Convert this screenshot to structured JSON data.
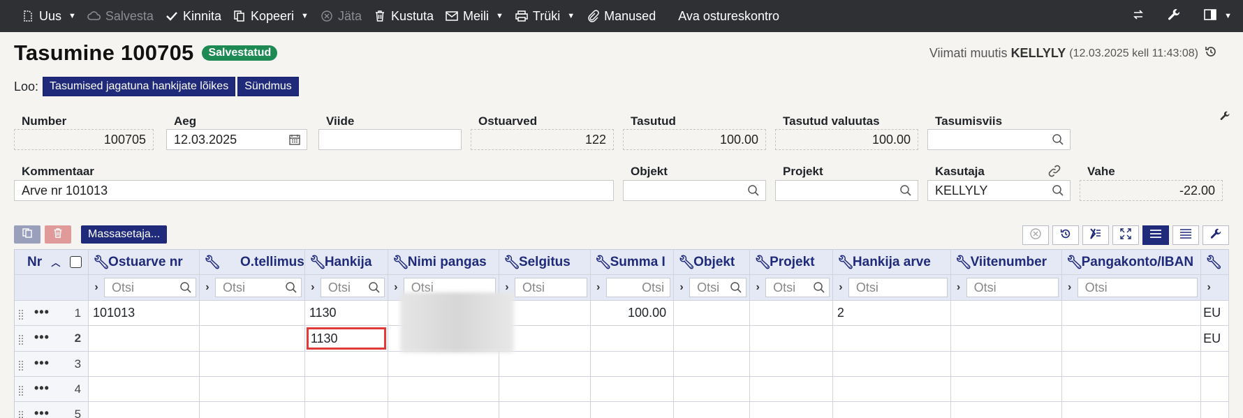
{
  "toolbar": {
    "uus": "Uus",
    "salvesta": "Salvesta",
    "kinnita": "Kinnita",
    "kopeeri": "Kopeeri",
    "jata": "Jäta",
    "kustuta": "Kustuta",
    "meili": "Meili",
    "truki": "Trüki",
    "manused": "Manused",
    "ava_ostureskontro": "Ava ostureskontro"
  },
  "header": {
    "title": "Tasumine 100705",
    "status": "Salvestatud",
    "modified_prefix": "Viimati muutis",
    "modified_user": "KELLYLY",
    "modified_time": "(12.03.2025 kell 11:43:08)"
  },
  "loo": {
    "label": "Loo:",
    "buttons": [
      "Tasumised jagatuna hankijate lõikes",
      "Sündmus"
    ]
  },
  "fields": {
    "number": {
      "label": "Number",
      "value": "100705"
    },
    "aeg": {
      "label": "Aeg",
      "value": "12.03.2025"
    },
    "viide": {
      "label": "Viide",
      "value": ""
    },
    "ostuarved": {
      "label": "Ostuarved",
      "value": "122"
    },
    "tasutud": {
      "label": "Tasutud",
      "value": "100.00"
    },
    "tasutud_valuutas": {
      "label": "Tasutud valuutas",
      "value": "100.00"
    },
    "tasumisviis": {
      "label": "Tasumisviis",
      "value": ""
    },
    "kommentaar": {
      "label": "Kommentaar",
      "value": "Arve nr 101013"
    },
    "objekt": {
      "label": "Objekt",
      "value": ""
    },
    "projekt": {
      "label": "Projekt",
      "value": ""
    },
    "kasutaja": {
      "label": "Kasutaja",
      "value": "KELLYLY"
    },
    "vahe": {
      "label": "Vahe",
      "value": "-22.00"
    }
  },
  "grid": {
    "mass_button": "Massasetaja...",
    "columns": [
      "Nr",
      "Ostuarve nr",
      "O.tellimus",
      "Hankija",
      "Nimi pangas",
      "Selgitus",
      "Summa I",
      "Objekt",
      "Projekt",
      "Hankija arve",
      "Viitenumber",
      "Pangakonto/IBAN"
    ],
    "filter_placeholder": "Otsi",
    "rows": [
      {
        "nr": "1",
        "ostuarve_nr": "101013",
        "o_tellimus": "",
        "hankija": "1130",
        "nimi_pangas": "",
        "selgitus": "",
        "summa": "100.00",
        "objekt": "",
        "projekt": "",
        "hankija_arve": "2",
        "viitenumber": "",
        "pangakonto": "",
        "extra": "EU"
      },
      {
        "nr": "2",
        "ostuarve_nr": "",
        "o_tellimus": "",
        "hankija": "1130",
        "nimi_pangas": "",
        "selgitus": "",
        "summa": "",
        "objekt": "",
        "projekt": "",
        "hankija_arve": "",
        "viitenumber": "",
        "pangakonto": "",
        "extra": "EU"
      },
      {
        "nr": "3"
      },
      {
        "nr": "4"
      },
      {
        "nr": "5"
      }
    ]
  },
  "colors": {
    "toolbar_bg": "#2f3034",
    "accent_navy": "#1f2a7a",
    "status_green": "#1e8a53",
    "highlight_red": "#e03a3a"
  }
}
